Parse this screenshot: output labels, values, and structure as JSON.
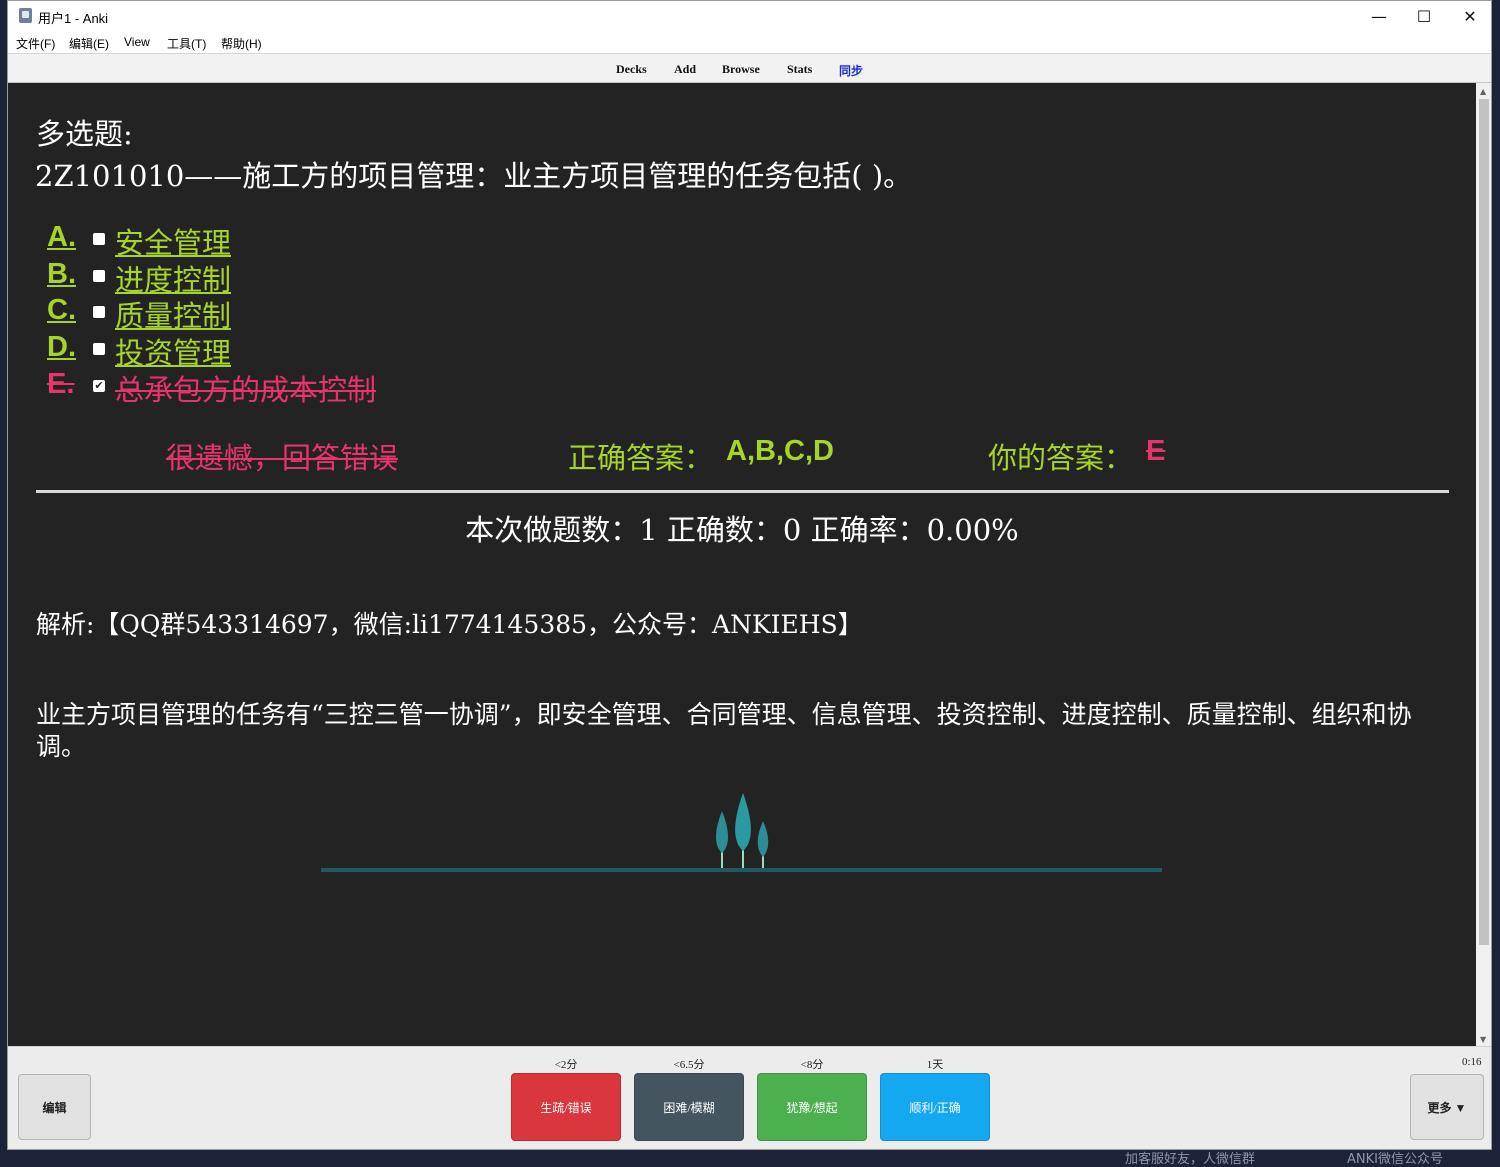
{
  "window": {
    "title": "用户1 - Anki",
    "controls": {
      "minimize": "—",
      "maximize": "☐",
      "close": "✕"
    }
  },
  "menu": {
    "items": [
      "文件(F)",
      "编辑(E)",
      "View",
      "工具(T)",
      "帮助(H)"
    ]
  },
  "toolbar": {
    "decks": "Decks",
    "add": "Add",
    "browse": "Browse",
    "stats": "Stats",
    "sync": "同步",
    "sync_color": "#1a2bd3"
  },
  "card": {
    "question_type": "多选题:",
    "question": "2Z101010——施工方的项目管理：业主方项目管理的任务包括( )。",
    "options": [
      {
        "letter": "A.",
        "text": "安全管理",
        "checked": false,
        "status": "correct"
      },
      {
        "letter": "B.",
        "text": "进度控制",
        "checked": false,
        "status": "correct"
      },
      {
        "letter": "C.",
        "text": "质量控制",
        "checked": false,
        "status": "correct"
      },
      {
        "letter": "D.",
        "text": "投资管理",
        "checked": false,
        "status": "correct"
      },
      {
        "letter": "E.",
        "text": "总承包方的成本控制",
        "checked": true,
        "status": "wrong"
      }
    ],
    "result_message": "很遗憾，回答错误",
    "correct_label": "正确答案：",
    "correct_value": "A,B,C,D",
    "your_label": "你的答案：",
    "your_value": "E",
    "stats_text": "本次做题数：1 正确数：0 正确率：0.00%",
    "analysis": "解析:【QQ群543314697，微信:li1774145385，公众号：ANKIEHS】",
    "explanation": "业主方项目管理的任务有“三控三管一协调”，即安全管理、合同管理、信息管理、投资控制、进度控制、质量控制、组织和协调。",
    "colors": {
      "correct": "#a6d52a",
      "wrong": "#e7346b",
      "background": "#232323"
    }
  },
  "bottom": {
    "edit_label": "编辑",
    "more_label": "更多 ▼",
    "timer": "0:16",
    "ease_buttons": [
      {
        "label": "生疏/错误",
        "interval": "<2分",
        "color": "#d9363e"
      },
      {
        "label": "困难/模糊",
        "interval": "<6.5分",
        "color": "#455560"
      },
      {
        "label": "犹豫/想起",
        "interval": "<8分",
        "color": "#4caf50"
      },
      {
        "label": "顺利/正确",
        "interval": "1天",
        "color": "#13a8f0"
      }
    ]
  },
  "desktop": {
    "text1": "加客服好友，人微信群",
    "text2": "ANKI微信公众号"
  }
}
